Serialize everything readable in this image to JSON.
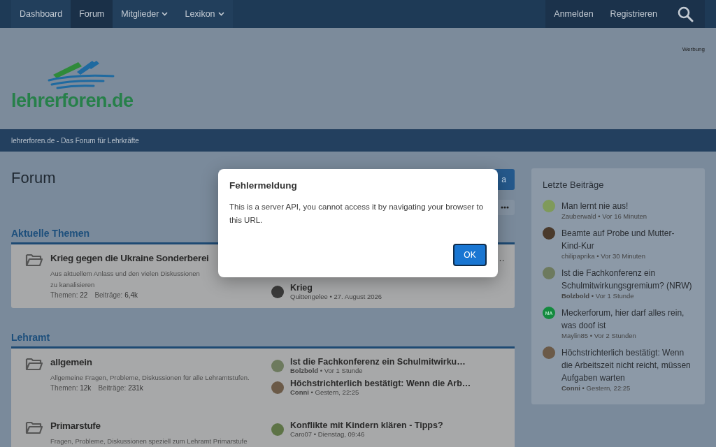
{
  "nav": {
    "items": [
      {
        "label": "Dashboard",
        "selected": false,
        "dropdown": false
      },
      {
        "label": "Forum",
        "selected": true,
        "dropdown": false
      },
      {
        "label": "Mitglieder",
        "selected": false,
        "dropdown": true
      },
      {
        "label": "Lexikon",
        "selected": false,
        "dropdown": true
      }
    ],
    "right": [
      "Anmelden",
      "Registrieren"
    ]
  },
  "header": {
    "logo": "lehrerforen.de",
    "ad_label": "Werbung"
  },
  "breadcrumb": "lehrerforen.de - Das Forum für Lehrkräfte",
  "page": {
    "title": "Forum",
    "new_button": "a"
  },
  "meta_separator": "•",
  "sections": [
    {
      "title": "Aktuelle Themen",
      "nodes": [
        {
          "title": "Krieg gegen die Ukraine Sonderberei",
          "description": [
            "Aus aktuellem Anlass und den vielen Diskussionen",
            "zu kanalisieren"
          ],
          "stats": [
            {
              "label": "Themen:",
              "value": "22"
            },
            {
              "label": "Beiträge:",
              "value": "6,4k"
            }
          ],
          "tail": "…",
          "posts": [
            {
              "title": "Krieg",
              "user": "Quittengelee",
              "time": "27. August 2026",
              "user_bold": false,
              "avatar": {
                "color": "#3a3a3a"
              }
            }
          ]
        }
      ]
    },
    {
      "title": "Lehramt",
      "nodes": [
        {
          "title": "allgemein",
          "description": [
            "Allgemeine Fragen, Probleme, Diskussionen für alle Lehramtstufen."
          ],
          "stats": [
            {
              "label": "Themen:",
              "value": "12k"
            },
            {
              "label": "Beiträge:",
              "value": "231k"
            }
          ],
          "posts": [
            {
              "title": "Ist die Fachkonferenz ein Schulmitwirku…",
              "user": "Bolzbold",
              "time": "Vor 1 Stunde",
              "user_bold": true,
              "avatar": {
                "color": "#6d7a5e"
              }
            },
            {
              "title": "Höchstrichterlich bestätigt: Wenn die Arb…",
              "user": "Conni",
              "time": "Gestern, 22:25",
              "user_bold": true,
              "avatar": {
                "color": "#6b5a48"
              }
            }
          ]
        },
        {
          "title": "Primarstufe",
          "description": [
            "Fragen, Probleme, Diskussionen speziell zum Lehramt Primarstufe"
          ],
          "posts": [
            {
              "title": "Konflikte mit Kindern klären - Tipps?",
              "user": "Caro07",
              "time": "Dienstag, 09:46",
              "user_bold": false,
              "avatar": {
                "color": "#5d7346"
              }
            }
          ]
        }
      ]
    }
  ],
  "sidebar": {
    "title": "Letzte Beiträge",
    "posts": [
      {
        "title": "Man lernt nie aus!",
        "user": "Zauberwald",
        "time": "Vor 16 Minuten",
        "user_bold": false,
        "avatar": {
          "color": "#7f9a5a"
        }
      },
      {
        "title": "Beamte auf Probe und Mutter-Kind-Kur",
        "user": "chilipaprika",
        "time": "Vor 30 Minuten",
        "user_bold": false,
        "avatar": {
          "color": "#4a3a2c"
        }
      },
      {
        "title": "Ist die Fachkonferenz ein Schulmitwirkungsgremium? (NRW)",
        "user": "Bolzbold",
        "time": "Vor 1 Stunde",
        "user_bold": true,
        "avatar": {
          "color": "#6d7a5e"
        }
      },
      {
        "title": "Meckerforum, hier darf alles rein, was doof ist",
        "user": "Maylin85",
        "time": "Vor 2 Stunden",
        "user_bold": false,
        "avatar": {
          "color": "#138a3e",
          "initials": "MA"
        }
      },
      {
        "title": "Höchstrichterlich bestätigt: Wenn die Arbeitszeit nicht reicht, müssen Aufgaben warten",
        "user": "Conni",
        "time": "Gestern, 22:25",
        "user_bold": true,
        "avatar": {
          "color": "#6b5a48"
        }
      }
    ]
  },
  "dialog": {
    "title": "Fehlermeldung",
    "message": "This is a server API, you cannot access it by navigating your browser to this URL.",
    "button": "OK"
  }
}
